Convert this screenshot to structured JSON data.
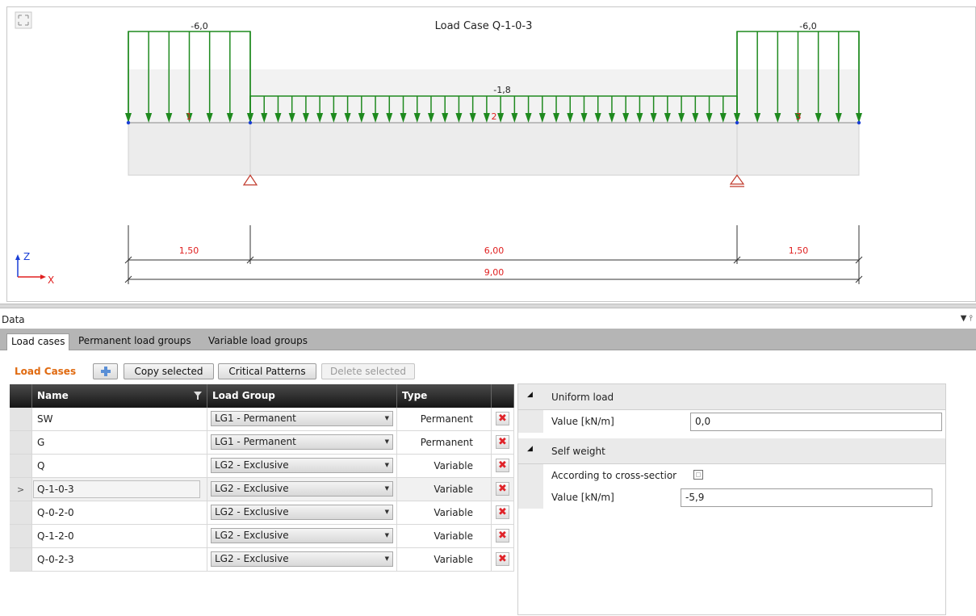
{
  "diagram": {
    "title": "Load Case Q-1-0-3",
    "load_left": "-6,0",
    "load_mid": "-1,8",
    "load_right": "-6,0",
    "span_labels": [
      "1",
      "2",
      "3"
    ],
    "dim_left": "1,50",
    "dim_mid": "6,00",
    "dim_right": "1,50",
    "dim_total": "9,00",
    "axis_z": "Z",
    "axis_x": "X",
    "expand_icon": "expand-icon"
  },
  "panel": {
    "title": "Data",
    "controls": "▼ ⫯"
  },
  "tabs": [
    {
      "label": "Load cases"
    },
    {
      "label": "Permanent load groups"
    },
    {
      "label": "Variable load groups"
    }
  ],
  "toolbar": {
    "title": "Load Cases",
    "add_icon": "plus-icon",
    "copy_label": "Copy selected",
    "critical_label": "Critical Patterns",
    "delete_label": "Delete selected"
  },
  "grid": {
    "headers": {
      "name": "Name",
      "filter_icon": "filter-icon",
      "load_group": "Load Group",
      "type": "Type"
    },
    "rows": [
      {
        "name": "SW",
        "load_group": "LG1 - Permanent",
        "type": "Permanent"
      },
      {
        "name": "G",
        "load_group": "LG1 - Permanent",
        "type": "Permanent"
      },
      {
        "name": "Q",
        "load_group": "LG2 - Exclusive",
        "type": "Variable"
      },
      {
        "name": "Q-1-0-3",
        "load_group": "LG2 - Exclusive",
        "type": "Variable"
      },
      {
        "name": "Q-0-2-0",
        "load_group": "LG2 - Exclusive",
        "type": "Variable"
      },
      {
        "name": "Q-1-2-0",
        "load_group": "LG2 - Exclusive",
        "type": "Variable"
      },
      {
        "name": "Q-0-2-3",
        "load_group": "LG2 - Exclusive",
        "type": "Variable"
      }
    ],
    "selected_row": 3
  },
  "properties": {
    "uniform_title": "Uniform load",
    "uniform_value_label": "Value [kN/m]",
    "uniform_value": "0,0",
    "self_title": "Self weight",
    "self_checkbox_label": "According to cross-sectior",
    "self_checkbox_checked": false,
    "self_value_label": "Value [kN/m]",
    "self_value": "-5,9"
  },
  "colors": {
    "load_arrow": "#1f8a1f",
    "dimension_text": "#e02020",
    "accent_title": "#e06a10",
    "support": "#c0392b"
  }
}
